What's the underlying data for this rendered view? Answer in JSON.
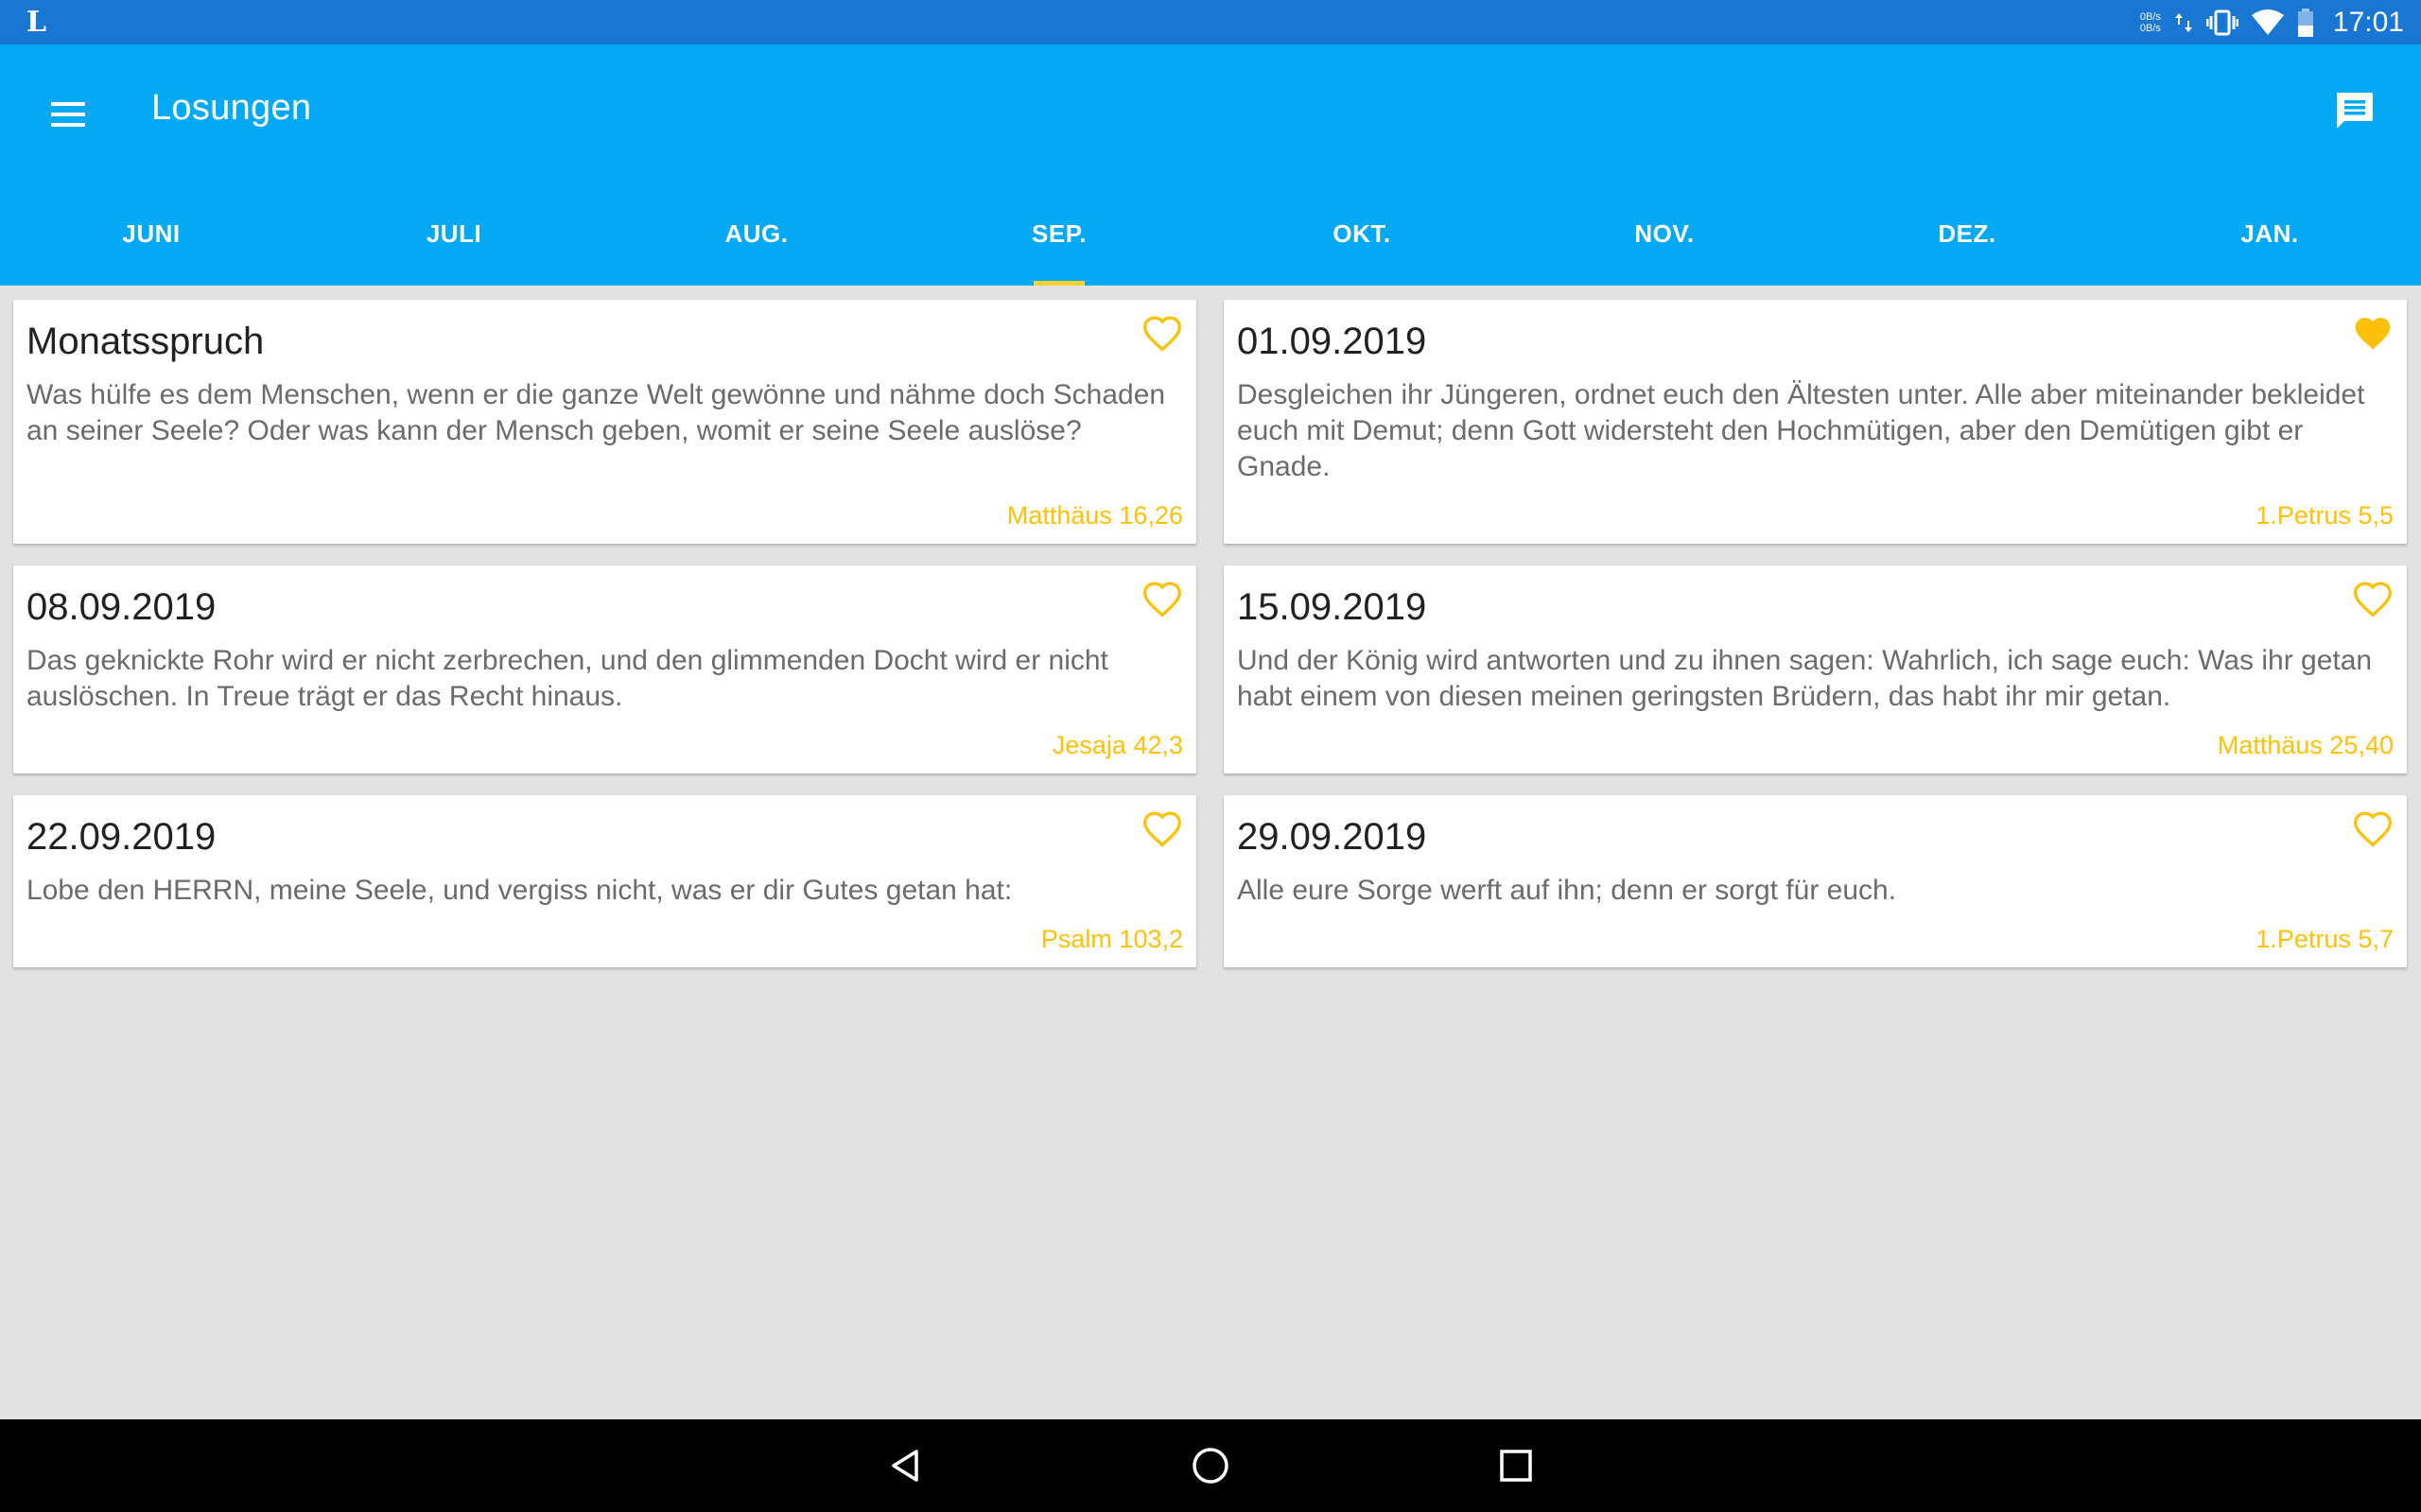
{
  "status_bar": {
    "app_letter": "L",
    "net_speed_up": "0B/s",
    "net_speed_down": "0B/s",
    "time": "17:01",
    "icons": [
      "data-arrows-icon",
      "vibrate-icon",
      "wifi-icon",
      "battery-icon"
    ]
  },
  "app_bar": {
    "title": "Losungen",
    "menu_icon": "hamburger-menu-icon",
    "action_icon": "feedback-message-icon"
  },
  "tabs": [
    {
      "label": "JUNI"
    },
    {
      "label": "JULI"
    },
    {
      "label": "AUG."
    },
    {
      "label": "SEP.",
      "active": true
    },
    {
      "label": "OKT."
    },
    {
      "label": "NOV."
    },
    {
      "label": "DEZ."
    },
    {
      "label": "JAN."
    }
  ],
  "colors": {
    "status_bar": "#1976d2",
    "app_bar": "#03a9f4",
    "accent": "#ffc107",
    "background": "#e2e2e2"
  },
  "cards": [
    {
      "title": "Monatsspruch",
      "text": "Was hülfe es dem Menschen, wenn er die ganze Welt gewönne und nähme doch Schaden an seiner Seele? Oder was kann der Mensch geben, womit er seine Seele auslöse?",
      "reference": "Matthäus 16,26",
      "favorite": false
    },
    {
      "title": "01.09.2019",
      "text": "Desgleichen ihr Jüngeren, ordnet euch den Ältesten unter. Alle aber miteinander bekleidet euch mit Demut; denn Gott widersteht den Hochmütigen, aber den Demütigen gibt er Gnade.",
      "reference": "1.Petrus 5,5",
      "favorite": true
    },
    {
      "title": "08.09.2019",
      "text": "Das geknickte Rohr wird er nicht zerbrechen, und den glimmenden Docht wird er nicht auslöschen. In Treue trägt er das Recht hinaus.",
      "reference": "Jesaja 42,3",
      "favorite": false
    },
    {
      "title": "15.09.2019",
      "text": "Und der König wird antworten und zu ihnen sagen: Wahrlich, ich sage euch: Was ihr getan habt einem von diesen meinen geringsten Brüdern, das habt ihr mir getan.",
      "reference": "Matthäus 25,40",
      "favorite": false
    },
    {
      "title": "22.09.2019",
      "text": "Lobe den HERRN, meine Seele, und vergiss nicht, was er dir Gutes getan hat:",
      "reference": "Psalm 103,2",
      "favorite": false
    },
    {
      "title": "29.09.2019",
      "text": "Alle eure Sorge werft auf ihn; denn er sorgt für euch.",
      "reference": "1.Petrus 5,7",
      "favorite": false
    }
  ],
  "nav_bar": {
    "buttons": [
      "back-icon",
      "home-icon",
      "recents-icon"
    ]
  }
}
